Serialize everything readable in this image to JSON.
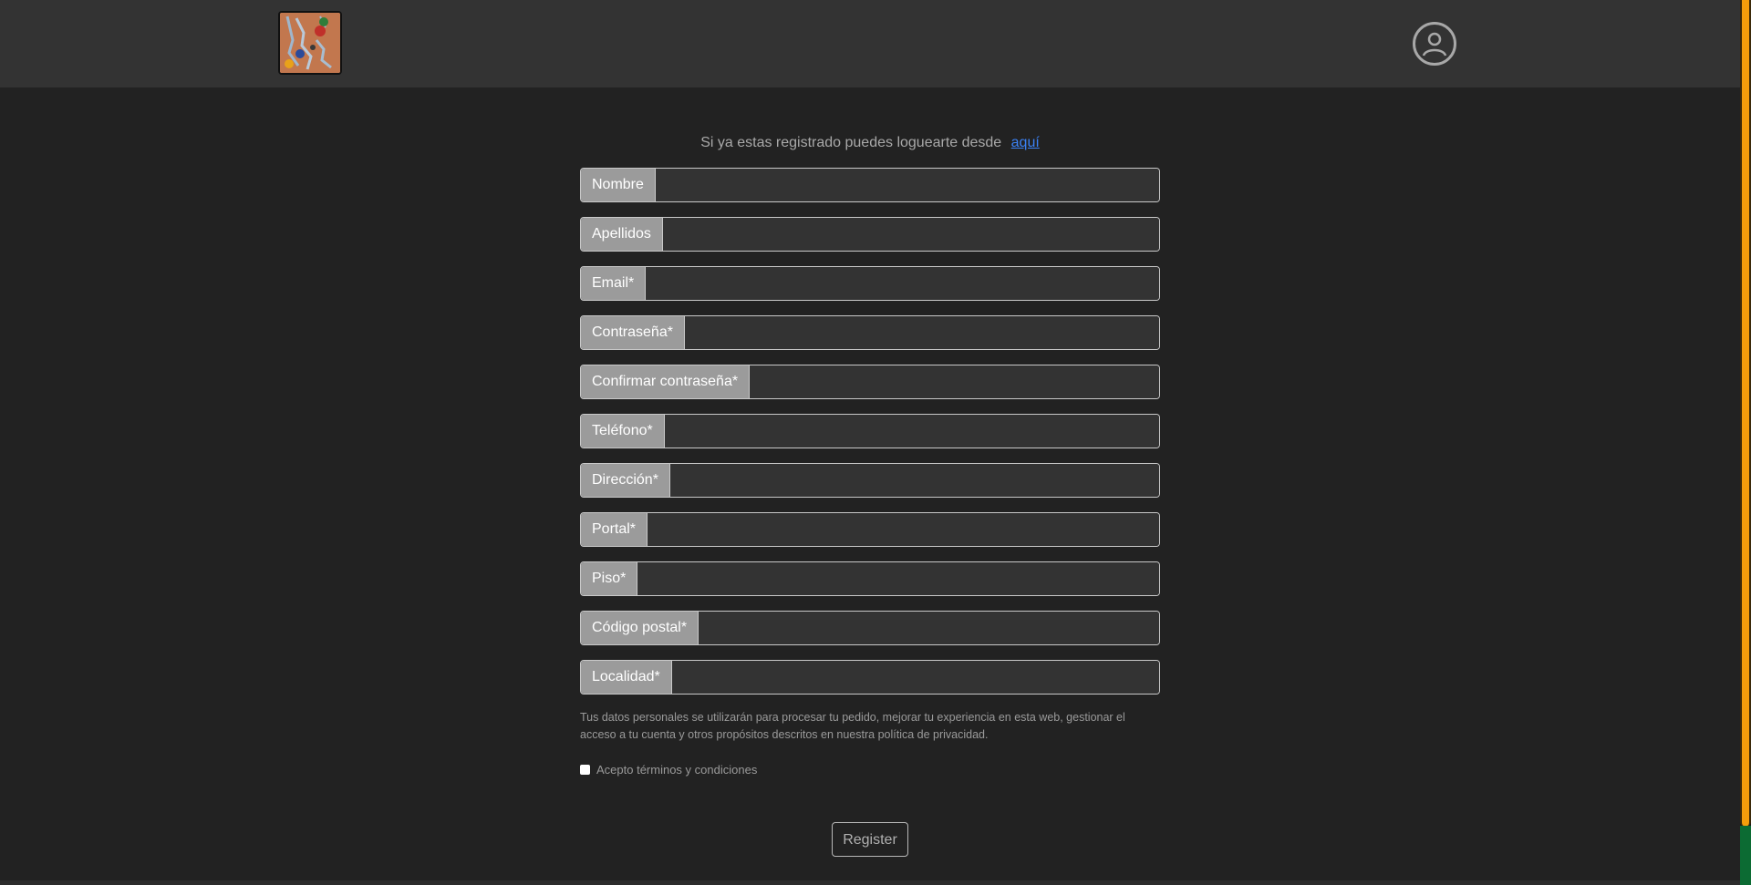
{
  "header": {
    "logo_alt": "logo",
    "user_icon": "user-circle-icon"
  },
  "login_hint": {
    "text": "Si ya estas registrado puedes loguearte desde",
    "link": "aquí"
  },
  "form": {
    "fields": [
      {
        "label": "Nombre",
        "value": ""
      },
      {
        "label": "Apellidos",
        "value": ""
      },
      {
        "label": "Email*",
        "value": ""
      },
      {
        "label": "Contraseña*",
        "value": ""
      },
      {
        "label": "Confirmar contraseña*",
        "value": ""
      },
      {
        "label": "Teléfono*",
        "value": ""
      },
      {
        "label": "Dirección*",
        "value": ""
      },
      {
        "label": "Portal*",
        "value": ""
      },
      {
        "label": "Piso*",
        "value": ""
      },
      {
        "label": "Código postal*",
        "value": ""
      },
      {
        "label": "Localidad*",
        "value": ""
      }
    ],
    "privacy_text": "Tus datos personales se utilizarán para procesar tu pedido, mejorar tu experiencia en esta web, gestionar el acceso a tu cuenta y otros propósitos descritos en nuestra política de privacidad.",
    "terms_label": "Acepto términos y condiciones",
    "terms_checked": false,
    "register_label": "Register"
  },
  "colors": {
    "background": "#222222",
    "navbar": "#333333",
    "label_bg": "#9b9b9b",
    "link": "#3b82f6",
    "scrollbar_thumb": "#f59e0b"
  }
}
